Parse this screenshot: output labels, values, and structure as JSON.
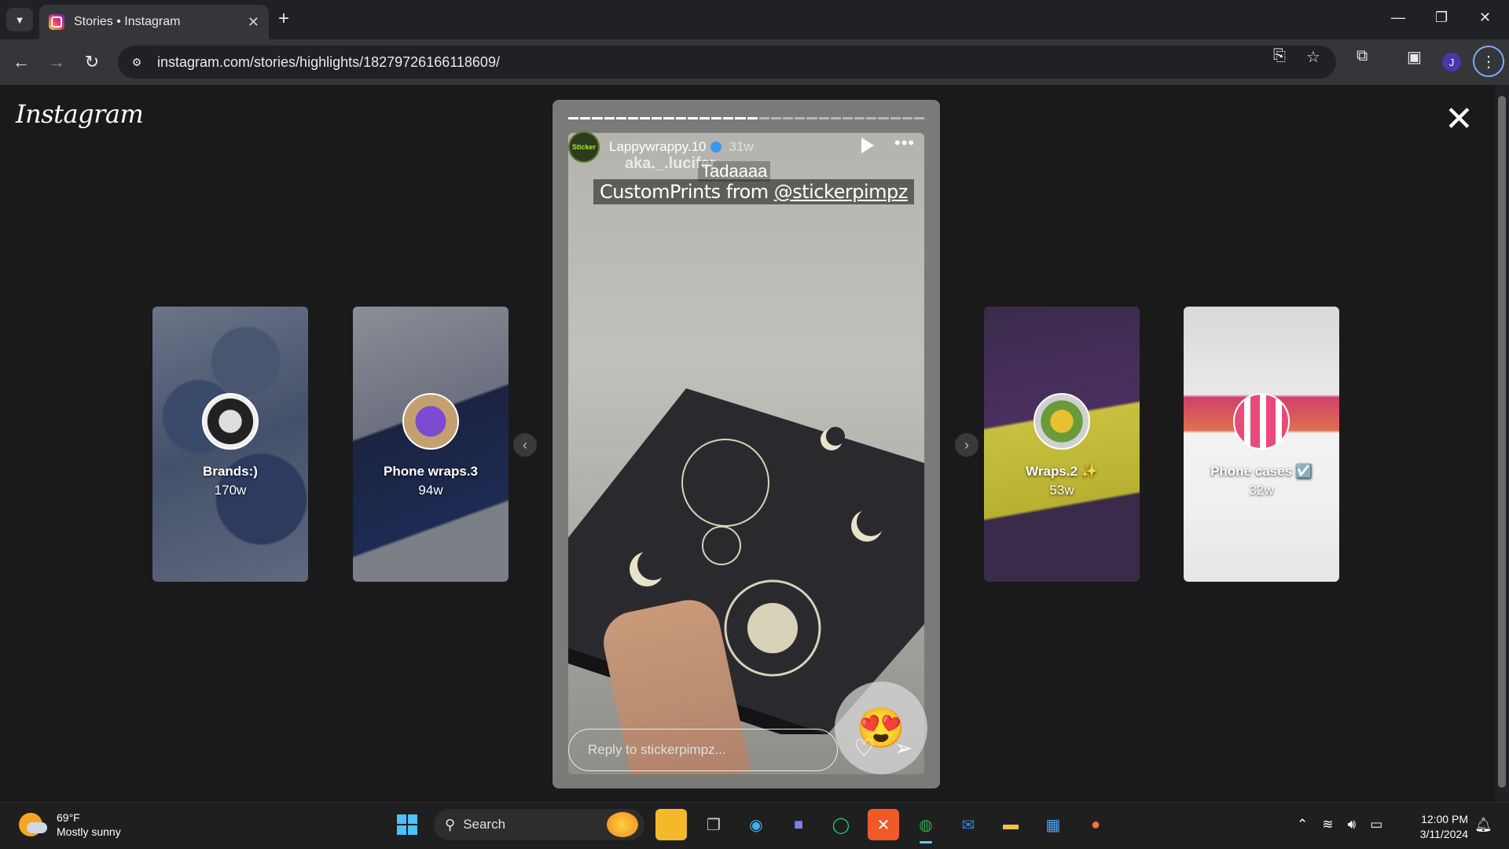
{
  "browser": {
    "tab_title": "Stories • Instagram",
    "url": "instagram.com/stories/highlights/18279726166118609/",
    "profile_initial": "J"
  },
  "page": {
    "logo": "Instagram",
    "story": {
      "username": "Lappywrappy.10",
      "time": "31w",
      "overlay_text_1": "aka._.lucifer",
      "overlay_text_2": "Tadaaaa",
      "caption_prefix": "CustomPrints from ",
      "caption_mention": "@stickerpimpz",
      "reply_placeholder": "Reply to stickerpimpz...",
      "emoji": "😍",
      "avatar_label": "Sticker",
      "progress_done": 16,
      "progress_total": 30
    },
    "side_stories": [
      {
        "title": "Brands:)",
        "time": "170w"
      },
      {
        "title": "Phone wraps.3",
        "time": "94w"
      },
      {
        "title": "Wraps.2 ✨",
        "time": "53w"
      },
      {
        "title": "Phone cases ☑️",
        "time": "32w"
      }
    ]
  },
  "taskbar": {
    "temperature": "69°F",
    "condition": "Mostly sunny",
    "search_label": "Search",
    "time": "12:00 PM",
    "date": "3/11/2024"
  },
  "colors": {
    "page_bg": "#1a1a1a",
    "accent_blue": "#3897f0",
    "chrome_dark": "#202124"
  }
}
